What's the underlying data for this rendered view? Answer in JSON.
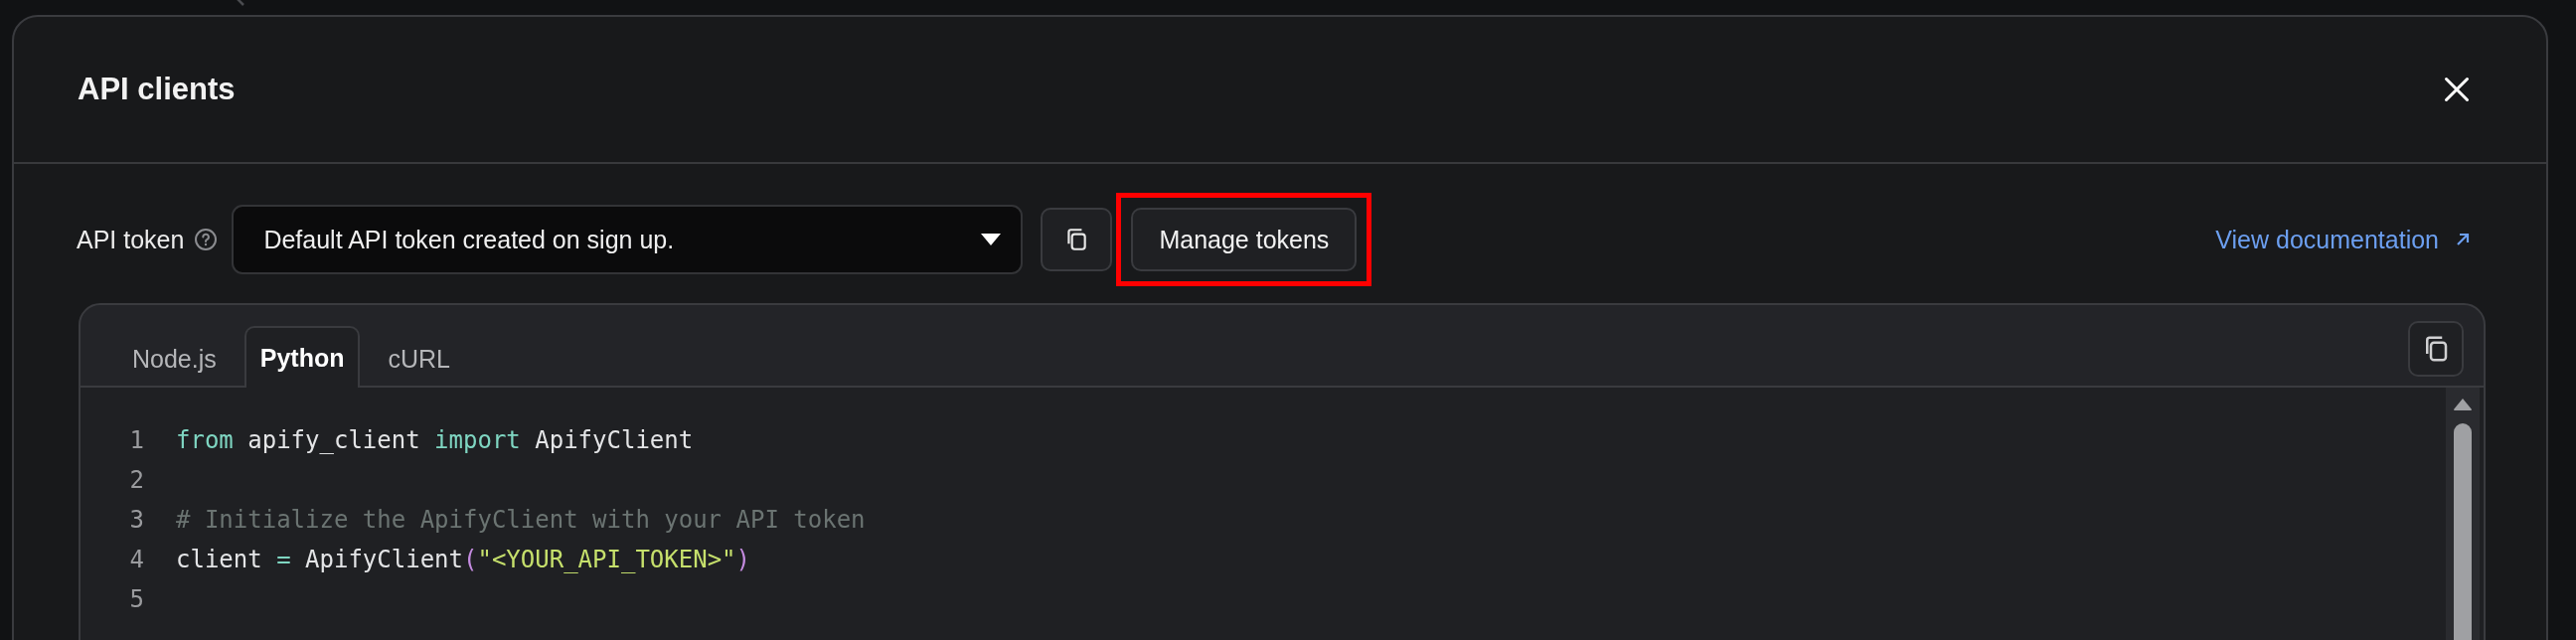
{
  "dialog": {
    "title": "API clients",
    "token": {
      "label": "API token",
      "value": "Default API token created on sign up."
    },
    "manage_button": "Manage tokens",
    "highlighted": true,
    "doc_link": "View documentation",
    "tabs": [
      {
        "label": "Node.js",
        "selected": false
      },
      {
        "label": "Python",
        "selected": true
      },
      {
        "label": "cURL",
        "selected": false
      }
    ],
    "code": [
      {
        "number": "1",
        "tokens": [
          {
            "text": "from",
            "kind": "keyword"
          },
          {
            "text": " apify_client ",
            "kind": "plain"
          },
          {
            "text": "import",
            "kind": "keyword"
          },
          {
            "text": " ApifyClient",
            "kind": "plain"
          }
        ]
      },
      {
        "number": "2"
      },
      {
        "number": "3",
        "tokens": [
          {
            "text": "# Initialize the ApifyClient with your API token",
            "kind": "comment"
          }
        ]
      },
      {
        "number": "4",
        "tokens": [
          {
            "text": "client ",
            "kind": "plain"
          },
          {
            "text": "=",
            "kind": "operator"
          },
          {
            "text": " ApifyClient",
            "kind": "plain"
          },
          {
            "text": "(",
            "kind": "paren"
          },
          {
            "text": "\"<YOUR_API_TOKEN>\"",
            "kind": "string"
          },
          {
            "text": ")",
            "kind": "paren"
          }
        ]
      },
      {
        "number": "5"
      }
    ]
  }
}
